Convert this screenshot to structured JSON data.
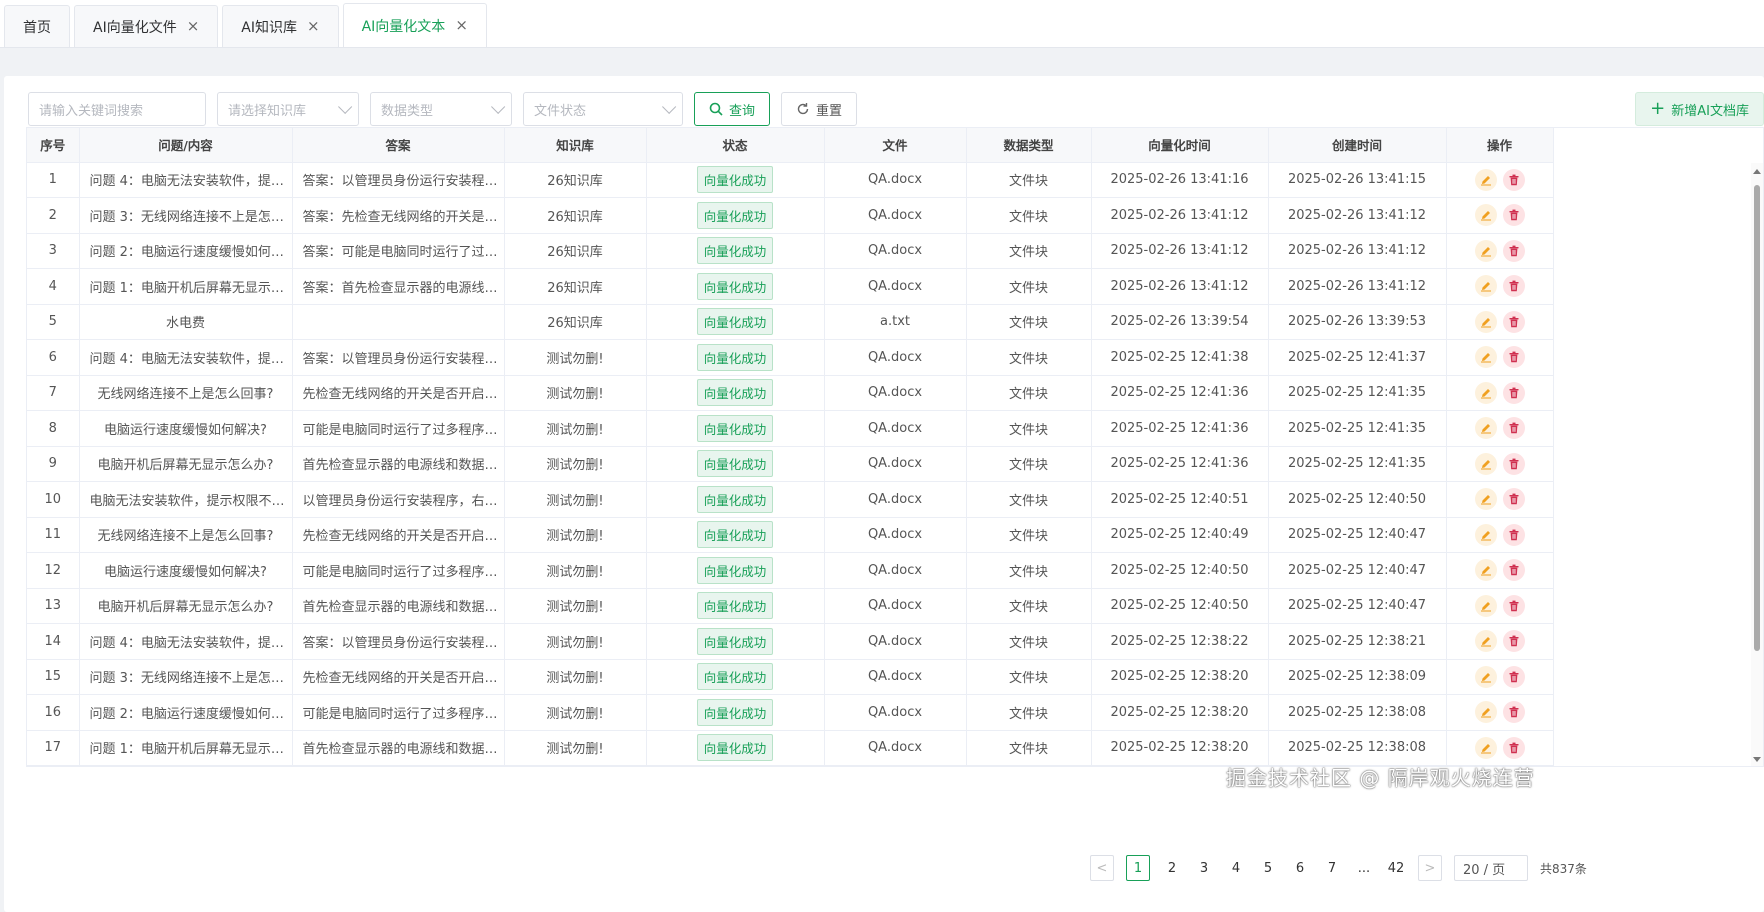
{
  "tabs": [
    {
      "label": "首页",
      "closable": false,
      "active": false
    },
    {
      "label": "AI向量化文件",
      "closable": true,
      "active": false
    },
    {
      "label": "AI知识库",
      "closable": true,
      "active": false
    },
    {
      "label": "AI向量化文本",
      "closable": true,
      "active": true
    }
  ],
  "filters": {
    "keyword_placeholder": "请输入关键词搜索",
    "kb_placeholder": "请选择知识库",
    "datatype_placeholder": "数据类型",
    "filestatus_placeholder": "文件状态",
    "query_label": "查询",
    "reset_label": "重置",
    "add_label": "新增AI文档库"
  },
  "table": {
    "headers": [
      "序号",
      "问题/内容",
      "答案",
      "知识库",
      "状态",
      "文件",
      "数据类型",
      "向量化时间",
      "创建时间",
      "操作"
    ],
    "rows": [
      {
        "no": "1",
        "q": "问题 4：电脑无法安装软件，提示...",
        "a": "答案：以管理员身份运行安装程序...",
        "kb": "26知识库",
        "status": "向量化成功",
        "file": "QA.docx",
        "dtype": "文件块",
        "vtime": "2025-02-26 13:41:16",
        "ctime": "2025-02-26 13:41:15"
      },
      {
        "no": "2",
        "q": "问题 3：无线网络连接不上是怎么...",
        "a": "答案：先检查无线网络的开关是否...",
        "kb": "26知识库",
        "status": "向量化成功",
        "file": "QA.docx",
        "dtype": "文件块",
        "vtime": "2025-02-26 13:41:12",
        "ctime": "2025-02-26 13:41:12"
      },
      {
        "no": "3",
        "q": "问题 2：电脑运行速度缓慢如何解...",
        "a": "答案：可能是电脑同时运行了过多...",
        "kb": "26知识库",
        "status": "向量化成功",
        "file": "QA.docx",
        "dtype": "文件块",
        "vtime": "2025-02-26 13:41:12",
        "ctime": "2025-02-26 13:41:12"
      },
      {
        "no": "4",
        "q": "问题 1：电脑开机后屏幕无显示怎...",
        "a": "答案：首先检查显示器的电源线和...",
        "kb": "26知识库",
        "status": "向量化成功",
        "file": "QA.docx",
        "dtype": "文件块",
        "vtime": "2025-02-26 13:41:12",
        "ctime": "2025-02-26 13:41:12"
      },
      {
        "no": "5",
        "q": "水电费",
        "a": "",
        "kb": "26知识库",
        "status": "向量化成功",
        "file": "a.txt",
        "dtype": "文件块",
        "vtime": "2025-02-26 13:39:54",
        "ctime": "2025-02-26 13:39:53",
        "qcenter": true
      },
      {
        "no": "6",
        "q": "问题 4：电脑无法安装软件，提示...",
        "a": "答案：以管理员身份运行安装程序...",
        "kb": "测试勿删!",
        "status": "向量化成功",
        "file": "QA.docx",
        "dtype": "文件块",
        "vtime": "2025-02-25 12:41:38",
        "ctime": "2025-02-25 12:41:37"
      },
      {
        "no": "7",
        "q": "无线网络连接不上是怎么回事?",
        "a": "先检查无线网络的开关是否开启，...",
        "kb": "测试勿删!",
        "status": "向量化成功",
        "file": "QA.docx",
        "dtype": "文件块",
        "vtime": "2025-02-25 12:41:36",
        "ctime": "2025-02-25 12:41:35",
        "qcenter": true
      },
      {
        "no": "8",
        "q": "电脑运行速度缓慢如何解决?",
        "a": "可能是电脑同时运行了过多程序导...",
        "kb": "测试勿删!",
        "status": "向量化成功",
        "file": "QA.docx",
        "dtype": "文件块",
        "vtime": "2025-02-25 12:41:36",
        "ctime": "2025-02-25 12:41:35",
        "qcenter": true
      },
      {
        "no": "9",
        "q": "电脑开机后屏幕无显示怎么办?",
        "a": "首先检查显示器的电源线和数据线...",
        "kb": "测试勿删!",
        "status": "向量化成功",
        "file": "QA.docx",
        "dtype": "文件块",
        "vtime": "2025-02-25 12:41:36",
        "ctime": "2025-02-25 12:41:35",
        "qcenter": true
      },
      {
        "no": "10",
        "q": "电脑无法安装软件，提示权限不足...",
        "a": "以管理员身份运行安装程序，右键...",
        "kb": "测试勿删!",
        "status": "向量化成功",
        "file": "QA.docx",
        "dtype": "文件块",
        "vtime": "2025-02-25 12:40:51",
        "ctime": "2025-02-25 12:40:50"
      },
      {
        "no": "11",
        "q": "无线网络连接不上是怎么回事?",
        "a": "先检查无线网络的开关是否开启，...",
        "kb": "测试勿删!",
        "status": "向量化成功",
        "file": "QA.docx",
        "dtype": "文件块",
        "vtime": "2025-02-25 12:40:49",
        "ctime": "2025-02-25 12:40:47",
        "qcenter": true
      },
      {
        "no": "12",
        "q": "电脑运行速度缓慢如何解决?",
        "a": "可能是电脑同时运行了过多程序导...",
        "kb": "测试勿删!",
        "status": "向量化成功",
        "file": "QA.docx",
        "dtype": "文件块",
        "vtime": "2025-02-25 12:40:50",
        "ctime": "2025-02-25 12:40:47",
        "qcenter": true
      },
      {
        "no": "13",
        "q": "电脑开机后屏幕无显示怎么办?",
        "a": "首先检查显示器的电源线和数据线...",
        "kb": "测试勿删!",
        "status": "向量化成功",
        "file": "QA.docx",
        "dtype": "文件块",
        "vtime": "2025-02-25 12:40:50",
        "ctime": "2025-02-25 12:40:47",
        "qcenter": true
      },
      {
        "no": "14",
        "q": "问题 4：电脑无法安装软件，提示...",
        "a": "答案：以管理员身份运行安装程序...",
        "kb": "测试勿删!",
        "status": "向量化成功",
        "file": "QA.docx",
        "dtype": "文件块",
        "vtime": "2025-02-25 12:38:22",
        "ctime": "2025-02-25 12:38:21"
      },
      {
        "no": "15",
        "q": "问题 3：无线网络连接不上是怎么...",
        "a": "先检查无线网络的开关是否开启，...",
        "kb": "测试勿删!",
        "status": "向量化成功",
        "file": "QA.docx",
        "dtype": "文件块",
        "vtime": "2025-02-25 12:38:20",
        "ctime": "2025-02-25 12:38:09"
      },
      {
        "no": "16",
        "q": "问题 2：电脑运行速度缓慢如何解...",
        "a": "可能是电脑同时运行了过多程序导...",
        "kb": "测试勿删!",
        "status": "向量化成功",
        "file": "QA.docx",
        "dtype": "文件块",
        "vtime": "2025-02-25 12:38:20",
        "ctime": "2025-02-25 12:38:08"
      },
      {
        "no": "17",
        "q": "问题 1：电脑开机后屏幕无显示怎...",
        "a": "首先检查显示器的电源线和数据线...",
        "kb": "测试勿删!",
        "status": "向量化成功",
        "file": "QA.docx",
        "dtype": "文件块",
        "vtime": "2025-02-25 12:38:20",
        "ctime": "2025-02-25 12:38:08"
      }
    ]
  },
  "pagination": {
    "prev": "<",
    "pages": [
      "1",
      "2",
      "3",
      "4",
      "5",
      "6",
      "7",
      "...",
      "42"
    ],
    "current": "1",
    "next": ">",
    "page_size": "20 / 页",
    "total": "共837条"
  },
  "watermark": "掘金技术社区 @ 隔岸观火烧连营",
  "colors": {
    "accent": "#18a058",
    "edit": "#f0a020",
    "delete": "#d03050"
  }
}
